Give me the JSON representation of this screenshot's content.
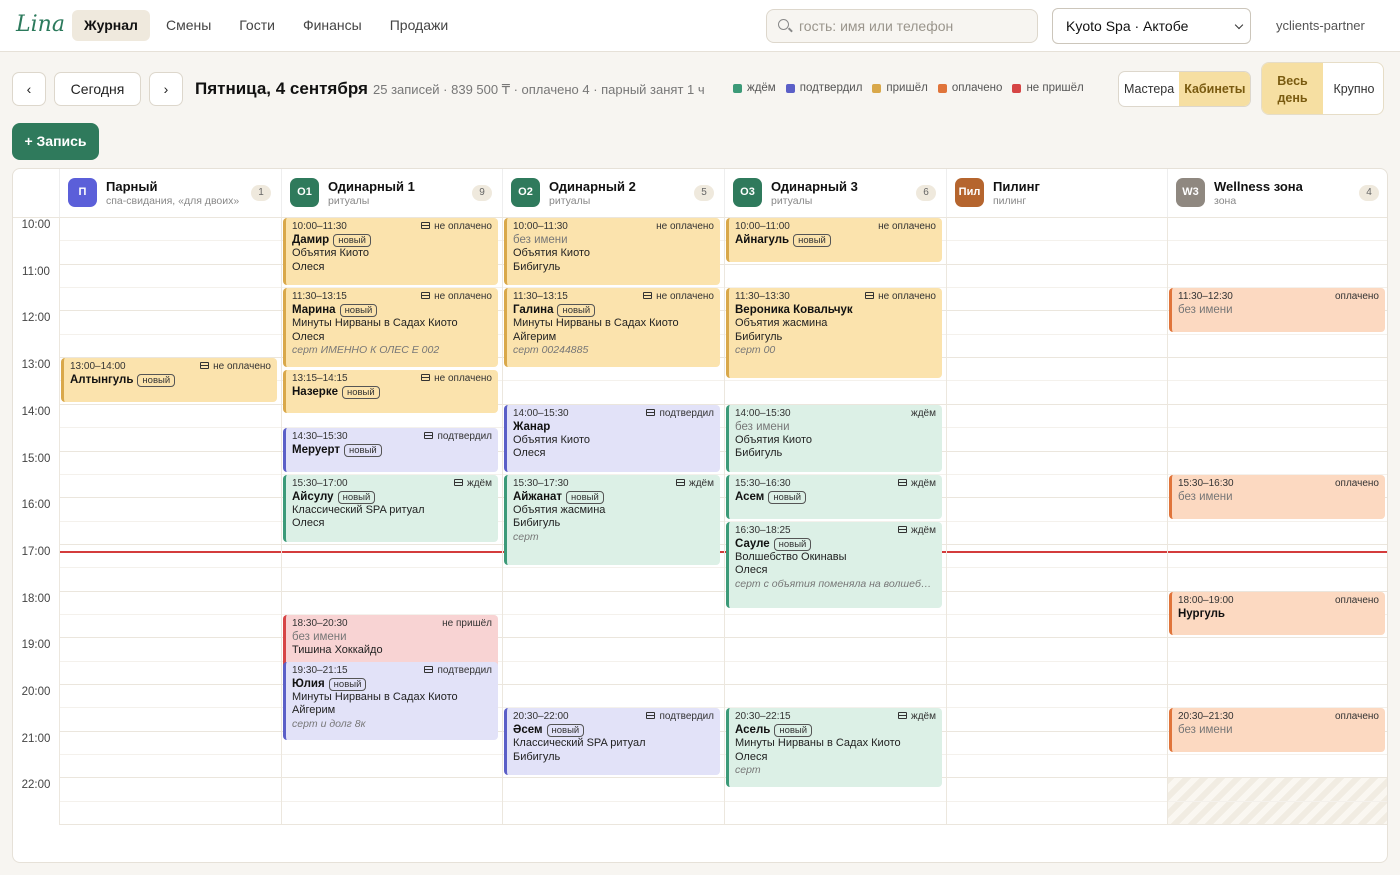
{
  "app": {
    "logo": "Lina",
    "nav": [
      "Журнал",
      "Смены",
      "Гости",
      "Финансы",
      "Продажи"
    ],
    "search_placeholder": "гость: имя или телефон",
    "branch": "Kyoto Spa · Актобе",
    "partner": "yclients-partner"
  },
  "toolbar": {
    "prev": "‹",
    "today": "Сегодня",
    "next": "›",
    "date": "Пятница, 4 сентября",
    "summary": "25 записей · 839 500 ₸ · оплачено 4 · парный занят 1 ч",
    "legend": [
      {
        "label": "ждём",
        "color": "#3c9a78"
      },
      {
        "label": "подтвердил",
        "color": "#5b5fc7"
      },
      {
        "label": "пришёл",
        "color": "#d9a84a"
      },
      {
        "label": "оплачено",
        "color": "#e0743a"
      },
      {
        "label": "не пришёл",
        "color": "#d64545"
      }
    ],
    "view_masters": "Мастера",
    "view_rooms": "Кабинеты",
    "range_day": "Весь день",
    "range_zoom": "Крупно",
    "new_record": "+ Запись"
  },
  "rooms": [
    {
      "badge": "П",
      "name": "Парный",
      "sub": "спа-свидания, «для двоих»",
      "count": "1",
      "color": "#5b5fd9"
    },
    {
      "badge": "О1",
      "name": "Одинарный 1",
      "sub": "ритуалы",
      "count": "9",
      "color": "#2f7a5c"
    },
    {
      "badge": "О2",
      "name": "Одинарный 2",
      "sub": "ритуалы",
      "count": "5",
      "color": "#2f7a5c"
    },
    {
      "badge": "О3",
      "name": "Одинарный 3",
      "sub": "ритуалы",
      "count": "6",
      "color": "#2f7a5c"
    },
    {
      "badge": "Пил",
      "name": "Пилинг",
      "sub": "пилинг",
      "count": "",
      "color": "#b5652e"
    },
    {
      "badge": "W3",
      "name": "Wellness зона",
      "sub": "зона",
      "count": "4",
      "color": "#8f8880"
    }
  ],
  "hours": [
    "10:00",
    "11:00",
    "12:00",
    "13:00",
    "14:00",
    "15:00",
    "16:00",
    "17:00",
    "18:00",
    "19:00",
    "20:00",
    "21:00",
    "22:00"
  ],
  "new_tag": "новый",
  "events": [
    {
      "room": 0,
      "start": "13:00",
      "end": "14:00",
      "time": "13:00–14:00",
      "status": "не оплачено",
      "kind": "unpaid",
      "card": true,
      "name": "Алтынгуль",
      "is_new": true,
      "lines": [],
      "note": ""
    },
    {
      "room": 1,
      "start": "10:00",
      "end": "11:30",
      "time": "10:00–11:30",
      "status": "не оплачено",
      "kind": "unpaid",
      "card": true,
      "name": "Дамир",
      "is_new": true,
      "lines": [
        "Объятия Киото",
        "Олеся"
      ],
      "note": ""
    },
    {
      "room": 1,
      "start": "11:30",
      "end": "13:15",
      "time": "11:30–13:15",
      "status": "не оплачено",
      "kind": "unpaid",
      "card": true,
      "name": "Марина",
      "is_new": true,
      "lines": [
        "Минуты Нирваны в Садах Киото",
        "Олеся"
      ],
      "note": "серт ИМЕННО К ОЛЕС Е 002"
    },
    {
      "room": 1,
      "start": "13:15",
      "end": "14:15",
      "time": "13:15–14:15",
      "status": "не оплачено",
      "kind": "unpaid",
      "card": true,
      "name": "Назерке",
      "is_new": true,
      "lines": [],
      "note": ""
    },
    {
      "room": 1,
      "start": "14:30",
      "end": "15:30",
      "time": "14:30–15:30",
      "status": "подтвердил",
      "kind": "conf",
      "card": true,
      "name": "Меруерт",
      "is_new": true,
      "lines": [],
      "note": ""
    },
    {
      "room": 1,
      "start": "15:30",
      "end": "17:00",
      "time": "15:30–17:00",
      "status": "ждём",
      "kind": "wait",
      "card": true,
      "name": "Айсулу",
      "is_new": true,
      "lines": [
        "Классический SPA ритуал",
        "Олеся"
      ],
      "note": ""
    },
    {
      "room": 1,
      "start": "18:30",
      "end": "20:30",
      "time": "18:30–20:30",
      "status": "не пришёл",
      "kind": "noshow",
      "card": false,
      "name": "без имени",
      "anon": true,
      "is_new": false,
      "lines": [
        "Тишина Хоккайдо"
      ],
      "note": ""
    },
    {
      "room": 1,
      "start": "19:30",
      "end": "21:15",
      "time": "19:30–21:15",
      "status": "подтвердил",
      "kind": "conf",
      "card": true,
      "name": "Юлия",
      "is_new": true,
      "lines": [
        "Минуты Нирваны в Садах Киото",
        "Айгерим"
      ],
      "note": "серт и долг 8к"
    },
    {
      "room": 2,
      "start": "10:00",
      "end": "11:30",
      "time": "10:00–11:30",
      "status": "не оплачено",
      "kind": "unpaid",
      "card": false,
      "name": "без имени",
      "anon": true,
      "is_new": false,
      "lines": [
        "Объятия Киото",
        "Бибигуль"
      ],
      "note": ""
    },
    {
      "room": 2,
      "start": "11:30",
      "end": "13:15",
      "time": "11:30–13:15",
      "status": "не оплачено",
      "kind": "unpaid",
      "card": true,
      "name": "Галина",
      "is_new": true,
      "lines": [
        "Минуты Нирваны в Садах Киото",
        "Айгерим"
      ],
      "note": "серт 00244885"
    },
    {
      "room": 2,
      "start": "14:00",
      "end": "15:30",
      "time": "14:00–15:30",
      "status": "подтвердил",
      "kind": "conf",
      "card": true,
      "name": "Жанар",
      "is_new": false,
      "lines": [
        "Объятия Киото",
        "Олеся"
      ],
      "note": ""
    },
    {
      "room": 2,
      "start": "15:30",
      "end": "17:30",
      "time": "15:30–17:30",
      "status": "ждём",
      "kind": "wait",
      "card": true,
      "name": "Айжанат",
      "is_new": true,
      "lines": [
        "Объятия жасмина",
        "Бибигуль"
      ],
      "note": "серт"
    },
    {
      "room": 2,
      "start": "20:30",
      "end": "22:00",
      "time": "20:30–22:00",
      "status": "подтвердил",
      "kind": "conf",
      "card": true,
      "name": "Әсем",
      "is_new": true,
      "lines": [
        "Классический SPA ритуал",
        "Бибигуль"
      ],
      "note": ""
    },
    {
      "room": 3,
      "start": "10:00",
      "end": "11:00",
      "time": "10:00–11:00",
      "status": "не оплачено",
      "kind": "unpaid",
      "card": false,
      "name": "Айнагуль",
      "is_new": true,
      "lines": [],
      "note": ""
    },
    {
      "room": 3,
      "start": "11:30",
      "end": "13:30",
      "time": "11:30–13:30",
      "status": "не оплачено",
      "kind": "unpaid",
      "card": true,
      "name": "Вероника Ковальчук",
      "is_new": false,
      "lines": [
        "Объятия жасмина",
        "Бибигуль"
      ],
      "note": "серт 00"
    },
    {
      "room": 3,
      "start": "14:00",
      "end": "15:30",
      "time": "14:00–15:30",
      "status": "ждём",
      "kind": "wait",
      "card": false,
      "name": "без имени",
      "anon": true,
      "is_new": false,
      "lines": [
        "Объятия Киото",
        "Бибигуль"
      ],
      "note": ""
    },
    {
      "room": 3,
      "start": "15:30",
      "end": "16:30",
      "time": "15:30–16:30",
      "status": "ждём",
      "kind": "wait",
      "card": true,
      "name": "Асем",
      "is_new": true,
      "lines": [],
      "note": ""
    },
    {
      "room": 3,
      "start": "16:30",
      "end": "18:25",
      "time": "16:30–18:25",
      "status": "ждём",
      "kind": "wait",
      "card": true,
      "name": "Сауле",
      "is_new": true,
      "lines": [
        "Волшебство Окинавы",
        "Олеся"
      ],
      "note": "серт с объятия поменяла на волшебст…"
    },
    {
      "room": 3,
      "start": "20:30",
      "end": "22:15",
      "time": "20:30–22:15",
      "status": "ждём",
      "kind": "wait",
      "card": true,
      "name": "Асель",
      "is_new": true,
      "lines": [
        "Минуты Нирваны в Садах Киото",
        "Олеся"
      ],
      "note": "серт"
    },
    {
      "room": 5,
      "start": "11:30",
      "end": "12:30",
      "time": "11:30–12:30",
      "status": "оплачено",
      "kind": "paid",
      "card": false,
      "name": "без имени",
      "anon": true,
      "is_new": false,
      "lines": [],
      "note": ""
    },
    {
      "room": 5,
      "start": "15:30",
      "end": "16:30",
      "time": "15:30–16:30",
      "status": "оплачено",
      "kind": "paid",
      "card": false,
      "name": "без имени",
      "anon": true,
      "is_new": false,
      "lines": [],
      "note": ""
    },
    {
      "room": 5,
      "start": "18:00",
      "end": "19:00",
      "time": "18:00–19:00",
      "status": "оплачено",
      "kind": "paid",
      "card": false,
      "name": "Нургуль",
      "is_new": false,
      "lines": [],
      "note": ""
    },
    {
      "room": 5,
      "start": "20:30",
      "end": "21:30",
      "time": "20:30–21:30",
      "status": "оплачено",
      "kind": "paid",
      "card": false,
      "name": "без имени",
      "anon": true,
      "is_new": false,
      "lines": [],
      "note": ""
    }
  ]
}
